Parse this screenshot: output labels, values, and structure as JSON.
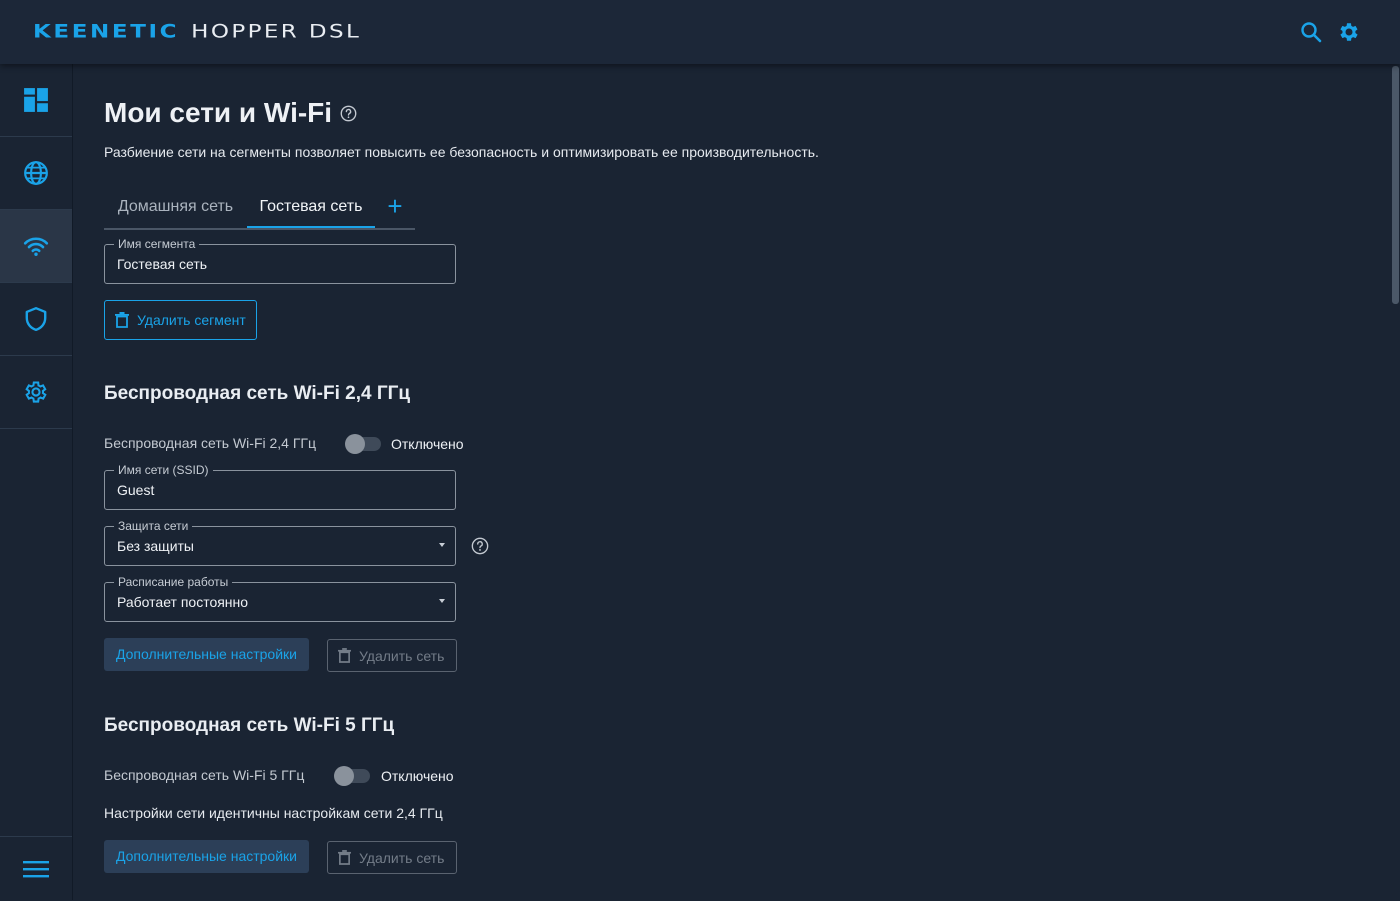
{
  "header": {
    "brand": "KEENETIC",
    "model": "HOPPER DSL",
    "search_icon": "search-icon",
    "settings_icon": "gear-icon"
  },
  "sidebar": {
    "items": [
      {
        "name": "dashboard",
        "icon": "dashboard-icon",
        "active": false
      },
      {
        "name": "internet",
        "icon": "globe-icon",
        "active": false
      },
      {
        "name": "wifi",
        "icon": "wifi-icon",
        "active": true
      },
      {
        "name": "security",
        "icon": "shield-icon",
        "active": false
      },
      {
        "name": "system",
        "icon": "gear-icon",
        "active": false
      }
    ],
    "menu_icon": "hamburger-icon"
  },
  "page": {
    "title": "Мои сети и Wi-Fi",
    "description": "Разбиение сети на сегменты позволяет повысить ее безопасность и оптимизировать ее производительность."
  },
  "tabs": [
    {
      "label": "Домашняя сеть",
      "active": false
    },
    {
      "label": "Гостевая сеть",
      "active": true
    },
    {
      "label": "+",
      "active": false
    }
  ],
  "segment": {
    "name_label": "Имя сегмента",
    "name_value": "Гостевая сеть",
    "delete_label": "Удалить сегмент"
  },
  "wifi24": {
    "title": "Беспроводная сеть Wi-Fi 2,4 ГГц",
    "toggle_label": "Беспроводная сеть Wi-Fi 2,4 ГГц",
    "toggle_state": "Отключено",
    "ssid_label": "Имя сети (SSID)",
    "ssid_value": "Guest",
    "security_label": "Защита сети",
    "security_value": "Без защиты",
    "schedule_label": "Расписание работы",
    "schedule_value": "Работает постоянно",
    "advanced_label": "Дополнительные настройки",
    "delete_label": "Удалить сеть"
  },
  "wifi5": {
    "title": "Беспроводная сеть Wi-Fi 5 ГГц",
    "toggle_label": "Беспроводная сеть Wi-Fi 5 ГГц",
    "toggle_state": "Отключено",
    "note": "Настройки сети идентичны настройкам сети 2,4 ГГц",
    "advanced_label": "Дополнительные настройки",
    "delete_label": "Удалить сеть"
  },
  "colors": {
    "accent": "#1aa3e8",
    "background": "#1a2433",
    "header": "#1c2738"
  }
}
